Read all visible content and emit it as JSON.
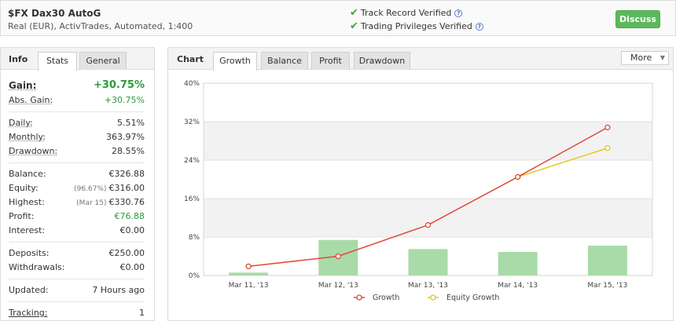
{
  "header": {
    "system_name": "$FX Dax30 AutoG",
    "system_desc": "Real (EUR), ActivTrades, Automated, 1:400",
    "verify_1": "Track Record Verified",
    "verify_2": "Trading Privileges Verified",
    "help_glyph": "?",
    "discuss_label": "Discuss"
  },
  "left_panel": {
    "header": "Info",
    "tabs": [
      "Stats",
      "General"
    ],
    "active_tab": "Stats",
    "gain": {
      "label": "Gain:",
      "value": "+30.75%"
    },
    "abs_gain": {
      "label": "Abs. Gain:",
      "value": "+30.75%"
    },
    "daily": {
      "label": "Daily:",
      "value": "5.51%"
    },
    "monthly": {
      "label": "Monthly:",
      "value": "363.97%"
    },
    "drawdown": {
      "label": "Drawdown:",
      "value": "28.55%"
    },
    "balance": {
      "label": "Balance:",
      "value": "€326.88"
    },
    "equity": {
      "label": "Equity:",
      "sub": "(96.67%)",
      "value": "€316.00"
    },
    "highest": {
      "label": "Highest:",
      "sub": "(Mar 15)",
      "value": "€330.76"
    },
    "profit": {
      "label": "Profit:",
      "value": "€76.88"
    },
    "interest": {
      "label": "Interest:",
      "value": "€0.00"
    },
    "deposits": {
      "label": "Deposits:",
      "value": "€250.00"
    },
    "withdrawals": {
      "label": "Withdrawals:",
      "value": "€0.00"
    },
    "updated": {
      "label": "Updated:",
      "value": "7 Hours ago"
    },
    "tracking": {
      "label": "Tracking:",
      "value": "1"
    }
  },
  "chart_panel": {
    "header": "Chart",
    "tabs": [
      "Growth",
      "Balance",
      "Profit",
      "Drawdown"
    ],
    "active_tab": "Growth",
    "more_label": "More"
  },
  "chart_data": {
    "type": "line",
    "categories": [
      "Mar 11, '13",
      "Mar 12, '13",
      "Mar 13, '13",
      "Mar 14, '13",
      "Mar 15, '13"
    ],
    "ylim": [
      0,
      40
    ],
    "yticks": [
      0,
      8,
      16,
      24,
      32,
      40
    ],
    "ytick_labels": [
      "0%",
      "8%",
      "16%",
      "24%",
      "32%",
      "40%"
    ],
    "grid": true,
    "legend_position": "bottom",
    "series": [
      {
        "name": "Growth",
        "kind": "line",
        "color": "#e04a3a",
        "values": [
          1.9,
          4.0,
          10.5,
          20.5,
          30.8
        ]
      },
      {
        "name": "Equity Growth",
        "kind": "line",
        "color": "#e6c619",
        "values": [
          null,
          null,
          null,
          20.5,
          26.5
        ]
      },
      {
        "kind": "bar",
        "color": "#a8dba8",
        "values": [
          0.6,
          7.4,
          5.5,
          4.9,
          6.2
        ]
      }
    ]
  },
  "colors": {
    "accent_green": "#2a9a3a",
    "button_green": "#5cb85c"
  }
}
